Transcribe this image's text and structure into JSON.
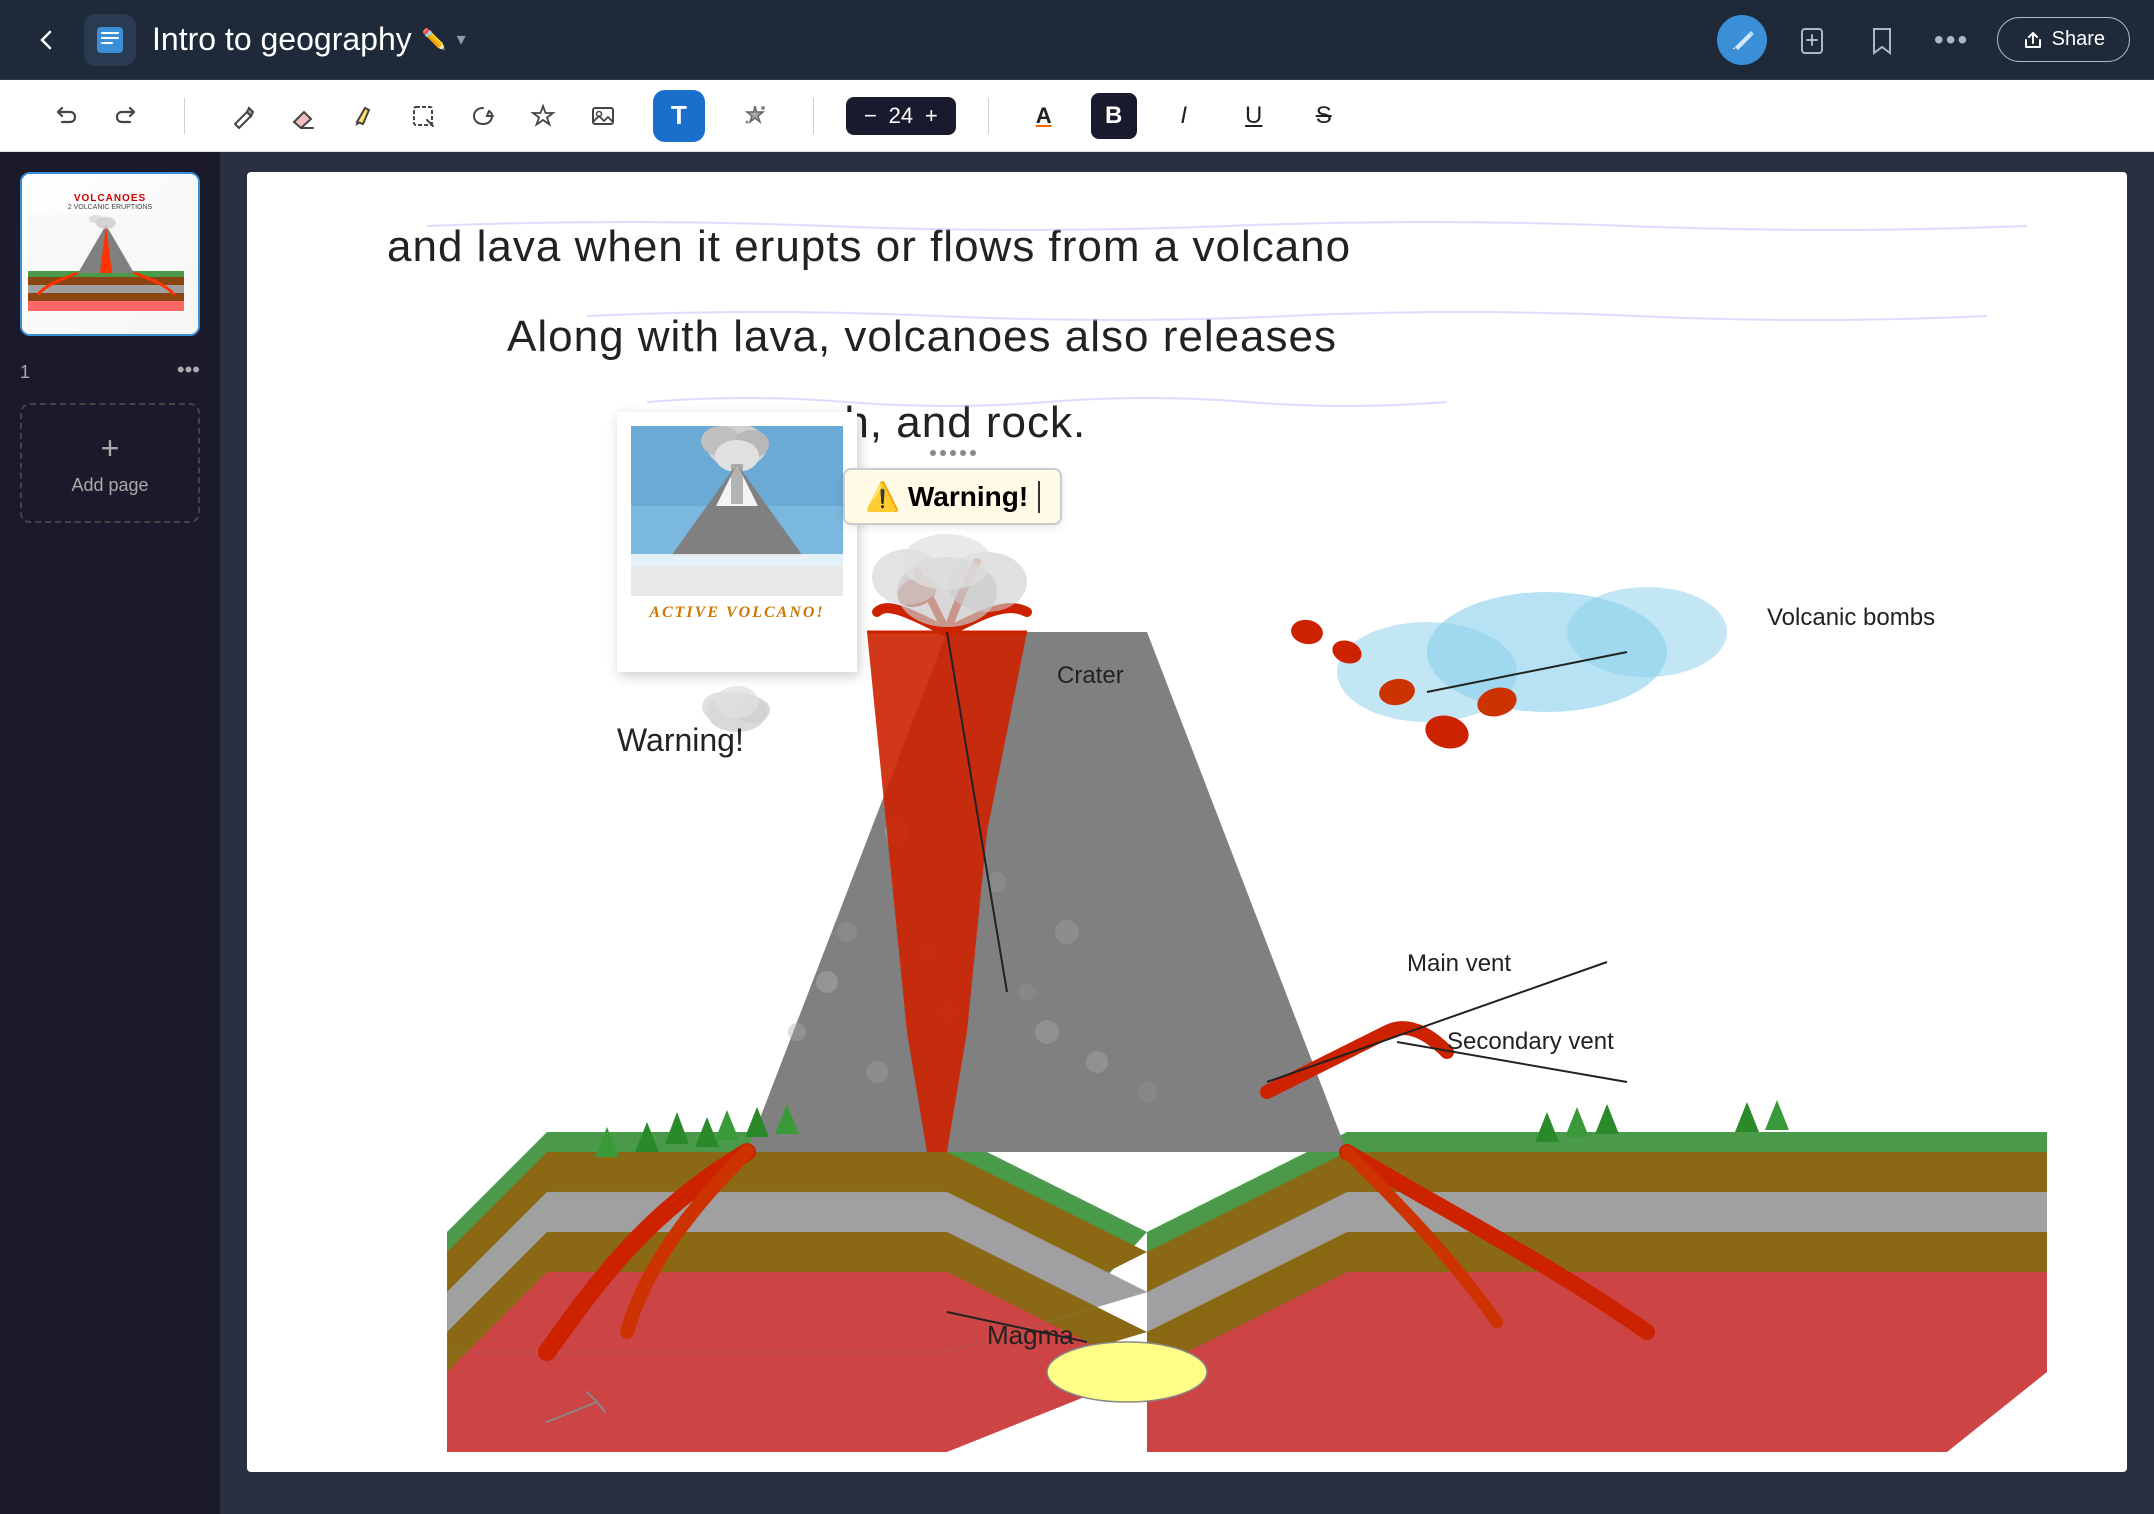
{
  "header": {
    "back_label": "←",
    "notebook_icon": "📓",
    "title": "Intro to geography",
    "title_pencil": "✏️",
    "title_arrow": "▾",
    "pen_icon": "✒️",
    "add_icon": "+",
    "bookmark_icon": "🔖",
    "more_icon": "•••",
    "share_icon": "↗",
    "share_label": "Share"
  },
  "toolbar": {
    "undo_icon": "↩",
    "redo_icon": "↪",
    "pen_tool_icon": "✏️",
    "eraser_icon": "⊘",
    "marker_icon": "🖊",
    "select_rect_icon": "⬚",
    "lasso_icon": "◌",
    "star_icon": "✦",
    "image_icon": "🖼",
    "text_tool_icon": "T",
    "magic_icon": "✨",
    "font_size_minus": "−",
    "font_size_value": "24",
    "font_size_plus": "+",
    "font_color_icon": "A",
    "bold_icon": "B",
    "italic_icon": "I",
    "underline_icon": "U",
    "strikethrough_icon": "S"
  },
  "sidebar": {
    "page_number": "1",
    "more_icon": "•••",
    "add_page_plus": "+",
    "add_page_label": "Add page"
  },
  "canvas": {
    "text_line1": "and lava when it erupts or flows from a volcano",
    "text_line2": "Along with lava, volcanoes also releases",
    "text_line3": "gases, ash, and rock.",
    "warning_emoji": "⚠️",
    "warning_text": "Warning!",
    "warning_standalone": "Warning!",
    "polaroid_caption": "ACTIVE VOLCANO!",
    "label_volcanic_bombs": "Volcanic bombs",
    "label_crater": "Crater",
    "label_main_vent": "Main vent",
    "label_secondary_vent": "Secondary vent",
    "label_magma": "Magma",
    "thumb_title": "VOLCANOES",
    "thumb_subtitle": "2 VOLCANIC ERUPTIONS"
  }
}
